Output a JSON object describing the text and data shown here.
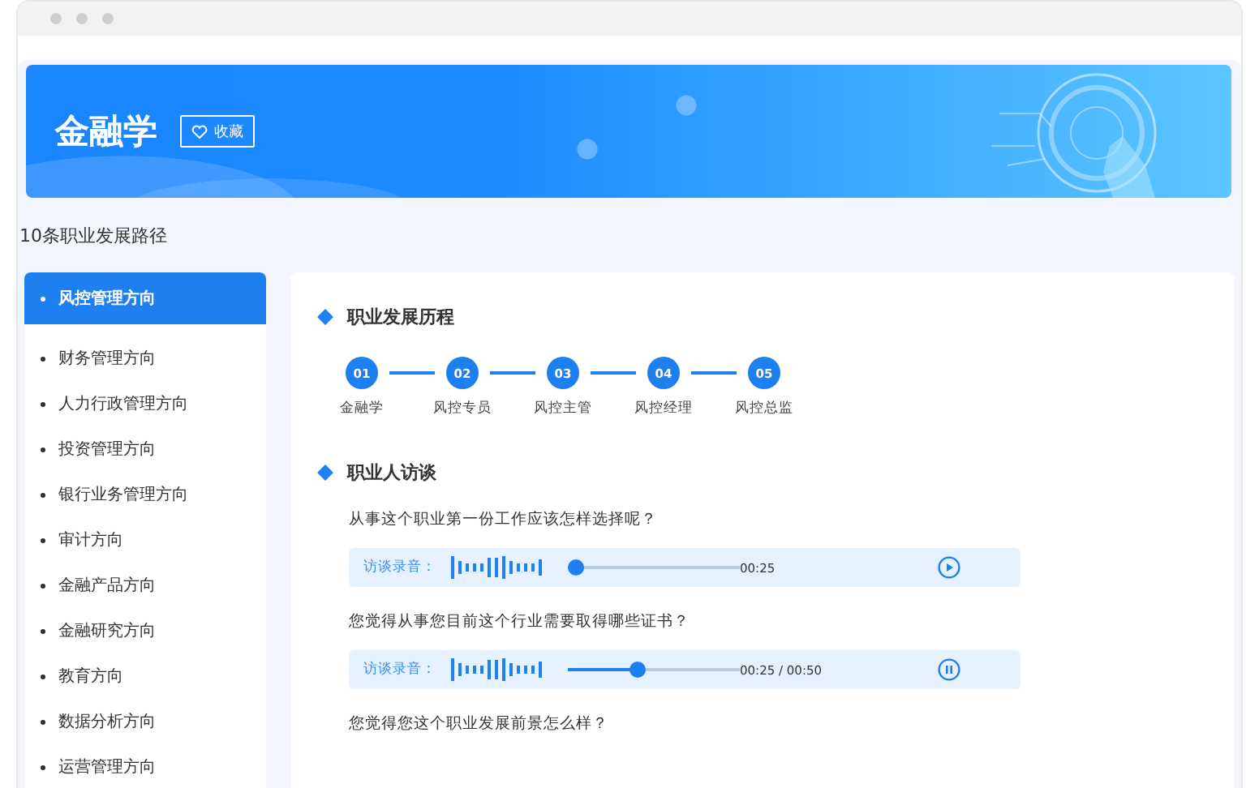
{
  "banner": {
    "title": "金融学",
    "favorite_button": {
      "label": "收藏"
    }
  },
  "paths_heading": "10条职业发展路径",
  "sidebar": {
    "items": [
      {
        "label": "风控管理方向",
        "selected": true
      },
      {
        "label": "财务管理方向",
        "selected": false
      },
      {
        "label": "人力行政管理方向",
        "selected": false
      },
      {
        "label": "投资管理方向",
        "selected": false
      },
      {
        "label": "银行业务管理方向",
        "selected": false
      },
      {
        "label": "审计方向",
        "selected": false
      },
      {
        "label": "金融产品方向",
        "selected": false
      },
      {
        "label": "金融研究方向",
        "selected": false
      },
      {
        "label": "教育方向",
        "selected": false
      },
      {
        "label": "数据分析方向",
        "selected": false
      },
      {
        "label": "运营管理方向",
        "selected": false
      }
    ]
  },
  "career": {
    "heading": "职业发展历程",
    "steps": [
      {
        "number": "01",
        "label": "金融学"
      },
      {
        "number": "02",
        "label": "风控专员"
      },
      {
        "number": "03",
        "label": "风控主管"
      },
      {
        "number": "04",
        "label": "风控经理"
      },
      {
        "number": "05",
        "label": "风控总监"
      }
    ]
  },
  "interviews": {
    "heading": "职业人访谈",
    "items": [
      {
        "question": "从事这个职业第一份工作应该怎样选择呢？",
        "player": {
          "label": "访谈录音：",
          "level": 0,
          "time": "00:25",
          "playing": false
        }
      },
      {
        "question": "您觉得从事您目前这个行业需要取得哪些证书？",
        "player": {
          "label": "访谈录音：",
          "level": 0.4,
          "time": "00:25 / 00:50",
          "playing": true
        }
      },
      {
        "question": "您觉得您这个职业发展前景怎么样？"
      }
    ]
  }
}
